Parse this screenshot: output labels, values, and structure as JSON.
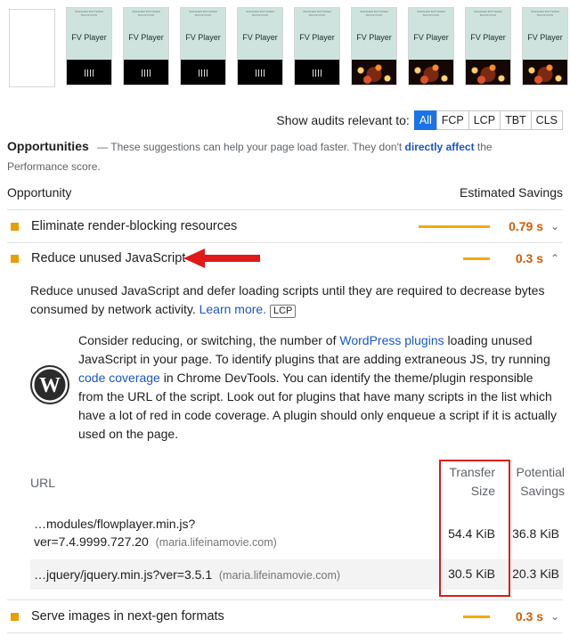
{
  "filmstrip": {
    "frames": [
      {
        "blank": true
      },
      {
        "small": "SMASHED BUTTERED BACON DON",
        "title": "FV Player",
        "video": "bars"
      },
      {
        "small": "SMASHED BUTTERED BACON DON",
        "title": "FV Player",
        "video": "bars"
      },
      {
        "small": "SMASHED BUTTERED BACON DON",
        "title": "FV Player",
        "video": "bars"
      },
      {
        "small": "SMASHED BUTTERED BACON DON",
        "title": "FV Player",
        "video": "bars"
      },
      {
        "small": "SMASHED BUTTERED BACON DON",
        "title": "FV Player",
        "video": "bars"
      },
      {
        "small": "SMASHED BUTTERED BACON DON",
        "title": "FV Player",
        "video": "lights"
      },
      {
        "small": "SMASHED BUTTERED BACON DON",
        "title": "FV Player",
        "video": "lights"
      },
      {
        "small": "SMASHED BUTTERED BACON DON",
        "title": "FV Player",
        "video": "lights"
      },
      {
        "small": "SMASHED BUTTERED BACON DON",
        "title": "FV Player",
        "video": "lights"
      }
    ]
  },
  "filter": {
    "label": "Show audits relevant to:",
    "chips": [
      "All",
      "FCP",
      "LCP",
      "TBT",
      "CLS"
    ],
    "active": "All"
  },
  "opportunities": {
    "heading": "Opportunities",
    "desc_prefix": "— These suggestions can help your page load faster. They don't",
    "desc_link": "directly affect",
    "desc_suffix": "the Performance score.",
    "col_left": "Opportunity",
    "col_right": "Estimated Savings"
  },
  "audits": {
    "render_blocking": {
      "title": "Eliminate render-blocking resources",
      "value": "0.79 s",
      "fraction": 0.79
    },
    "unused_js": {
      "title": "Reduce unused JavaScript",
      "value": "0.3 s",
      "fraction": 0.3,
      "description": "Reduce unused JavaScript and defer loading scripts until they are required to decrease bytes consumed by network activity.",
      "learn_more": "Learn more.",
      "metric_tag": "LCP",
      "wp": {
        "t1": "Consider reducing, or switching, the number of",
        "link1": "WordPress plugins",
        "t2": "loading unused JavaScript in your page. To identify plugins that are adding extraneous JS, try running",
        "link2": "code coverage",
        "t3": "in Chrome DevTools. You can identify the theme/plugin responsible from the URL of the script. Look out for plugins that have many scripts in the list which have a lot of red in code coverage. A plugin should only enqueue a script if it is actually used on the page."
      },
      "table": {
        "col_url": "URL",
        "col_transfer_1": "Transfer",
        "col_transfer_2": "Size",
        "col_savings_1": "Potential",
        "col_savings_2": "Savings",
        "rows": [
          {
            "url_1": "…modules/flowplayer.min.js?",
            "url_2": "ver=7.4.9999.727.20",
            "host": "(maria.lifeinamovie.com)",
            "transfer": "54.4 KiB",
            "savings": "36.8 KiB"
          },
          {
            "url_1": "…jquery/jquery.min.js?ver=3.5.1",
            "url_2": "",
            "host": "(maria.lifeinamovie.com)",
            "transfer": "30.5 KiB",
            "savings": "20.3 KiB"
          }
        ]
      }
    },
    "next_gen": {
      "title": "Serve images in next-gen formats",
      "value": "0.3 s",
      "fraction": 0.3
    }
  },
  "colors": {
    "accent": "#1a73e8",
    "warn": "#e8a000",
    "highlight": "#e11919"
  }
}
